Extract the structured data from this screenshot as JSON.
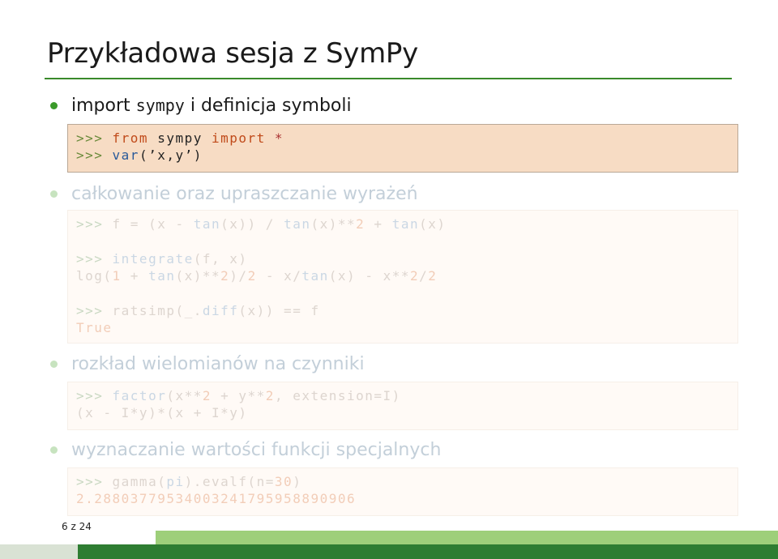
{
  "slide": {
    "title": "Przykładowa sesja z SymPy",
    "page": "6 z 24"
  },
  "items": [
    {
      "pre": "import ",
      "code": "sympy",
      "post": " i definicja symboli",
      "lines": [
        [
          ">>> ",
          "from",
          " sympy ",
          "import",
          " *"
        ],
        [
          ">>> ",
          "var",
          "(’x,y’)"
        ]
      ]
    },
    {
      "label": "całkowanie oraz upraszczanie wyrażeń",
      "lines": [
        [
          ">>> ",
          "f = (x - ",
          "tan",
          "(x)) / ",
          "tan",
          "(x)**",
          "2",
          " + ",
          "tan",
          "(x)"
        ],
        [
          ">>> ",
          "integrate",
          "(f, x)"
        ],
        [
          "log(",
          "1",
          " + ",
          "tan",
          "(x)**",
          "2",
          ")/",
          "2",
          " - x/",
          "tan",
          "(x) - x**",
          "2",
          "/",
          "2"
        ],
        [
          ">>> ",
          "ratsimp(_.",
          "diff",
          "(x)) == f"
        ],
        [
          "True"
        ]
      ]
    },
    {
      "label": "rozkład wielomianów na czynniki",
      "lines": [
        [
          ">>> ",
          "factor",
          "(x**",
          "2",
          " + y**",
          "2",
          ", extension=I)"
        ],
        [
          "(x - I*y)*(x + I*y)"
        ]
      ]
    },
    {
      "label": "wyznaczanie wartości funkcji specjalnych",
      "lines": [
        [
          ">>> ",
          "gamma(",
          "pi",
          ").evalf(n=",
          "30",
          ")"
        ],
        [
          "2.28803779534003241795958890906"
        ]
      ]
    }
  ],
  "colors": {
    "accent": "#3a8a2a",
    "highlight_bg": "#f7dcc4",
    "footer_light": "#9ecf7a",
    "footer_dark": "#2e7d32"
  }
}
